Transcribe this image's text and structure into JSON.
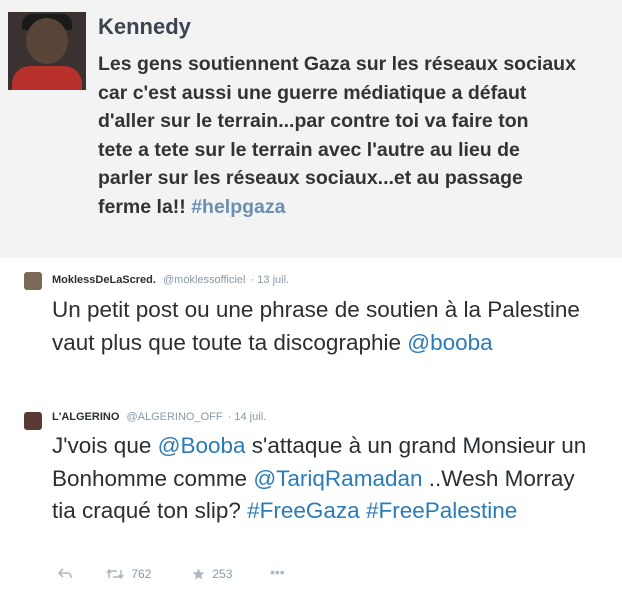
{
  "tweet1": {
    "author": "Kennedy",
    "text": "Les gens soutiennent Gaza sur les réseaux sociaux\ncar c'est aussi une guerre médiatique a défaut\nd'aller sur le terrain...par contre toi va faire ton\ntete a tete sur le terrain avec l'autre au lieu de\nparler sur les réseaux sociaux...et au passage\nferme la!! ",
    "hashtag": "#helpgaza"
  },
  "tweet2": {
    "author": "MoklessDeLaScred.",
    "handle": "@moklessofficiel",
    "date": "· 13 juil.",
    "text": "Un petit post ou une phrase de soutien à la Palestine vaut plus que toute ta discographie ",
    "mention": "@booba"
  },
  "tweet3": {
    "author": "L'ALGERINO",
    "handle": "@ALGERINO_OFF",
    "date": "· 14 juil.",
    "text_a": "J'vois que ",
    "mention1": "@Booba",
    "text_b": " s'attaque à un grand Monsieur un Bonhomme comme ",
    "mention2": "@TariqRamadan",
    "text_c": " ..Wesh Morray tia craqué ton slip? ",
    "hashtag1": "#FreeGaza",
    "hashtag2": "#FreePalestine",
    "retweets": "762",
    "favorites": "253"
  },
  "icons": [
    "reply-icon",
    "retweet-icon",
    "favorite-icon",
    "more-icon"
  ],
  "colors": {
    "link": "#2b7bb9",
    "meta": "#8899a6",
    "hashtag_screenshot": "#6a8fb3"
  }
}
